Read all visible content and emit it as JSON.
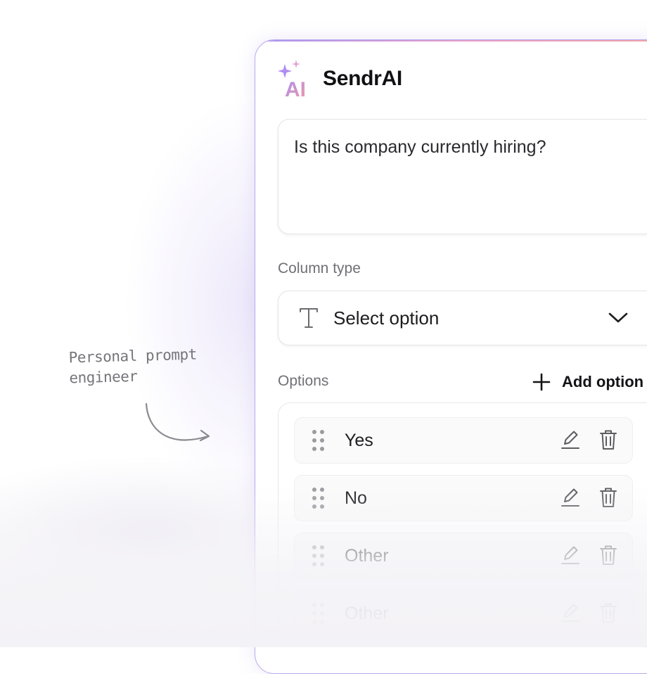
{
  "app": {
    "name": "SendrAI",
    "logo_text": "AI"
  },
  "annotation": {
    "line1": "Personal prompt",
    "line2": "engineer"
  },
  "prompt": {
    "text": "Is this company currently hiring?"
  },
  "column_type": {
    "label": "Column type",
    "value": "Select option"
  },
  "options_section": {
    "label": "Options",
    "add_label": "Add option",
    "items": [
      {
        "label": "Yes"
      },
      {
        "label": "No"
      },
      {
        "label": "Other"
      },
      {
        "label": "Other"
      }
    ]
  },
  "colors": {
    "accent_purple": "#a996ef",
    "accent_pink": "#f2a6a6",
    "text_primary": "#1c1c1f",
    "text_muted": "#707076"
  },
  "icons": [
    "sparkle-icon",
    "text-type-icon",
    "chevron-down-icon",
    "plus-icon",
    "drag-handle-icon",
    "pencil-icon",
    "trash-icon",
    "curved-arrow-icon"
  ]
}
